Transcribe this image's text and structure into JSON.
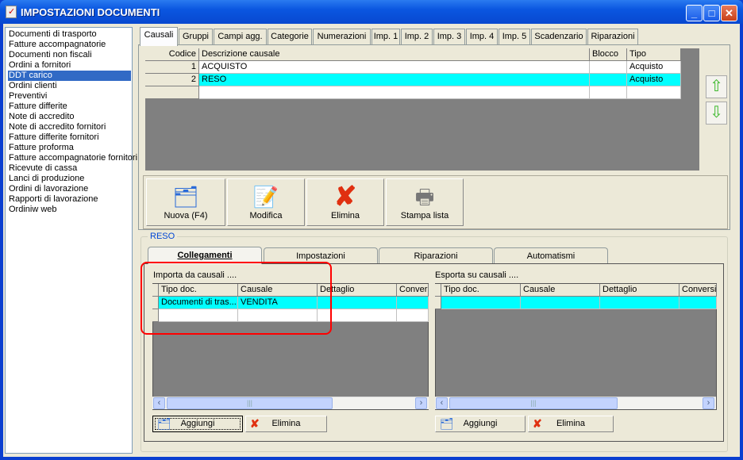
{
  "window": {
    "title": "IMPOSTAZIONI DOCUMENTI",
    "minimize": "_",
    "maximize": "□",
    "close": "✕"
  },
  "sidebar": {
    "items": [
      "Documenti di trasporto",
      "Fatture accompagnatorie",
      "Documenti non fiscali",
      "Ordini a fornitori",
      "DDT carico",
      "Ordini clienti",
      "Preventivi",
      "Fatture differite",
      "Note di accredito",
      "Note di accredito fornitori",
      "Fatture differite fornitori",
      "Fatture proforma",
      "Fatture accompagnatorie fornitori",
      "Ricevute di cassa",
      "Lanci di produzione",
      "Ordini di lavorazione",
      "Rapporti di lavorazione",
      "Ordiniw web"
    ],
    "selected": "DDT carico"
  },
  "tabs": [
    "Causali",
    "Gruppi",
    "Campi agg.",
    "Categorie",
    "Numerazioni",
    "Imp. 1",
    "Imp. 2",
    "Imp. 3",
    "Imp. 4",
    "Imp. 5",
    "Scadenzario",
    "Riparazioni"
  ],
  "causali": {
    "headers": [
      "Codice",
      "Descrizione causale",
      "Blocco",
      "Tipo"
    ],
    "rows": [
      [
        "1",
        "ACQUISTO",
        "",
        "Acquisto"
      ],
      [
        "2",
        "RESO",
        "",
        "Acquisto"
      ]
    ]
  },
  "toolbar": {
    "nuova": "Nuova (F4)",
    "modifica": "Modifica",
    "elimina": "Elimina",
    "stampa": "Stampa lista"
  },
  "group": {
    "label": "RESO",
    "tabs": [
      "Collegamenti",
      "Impostazioni",
      "Riparazioni",
      "Automatismi"
    ]
  },
  "importa": {
    "label": "Importa da causali ....",
    "headers": [
      "Tipo doc.",
      "Causale",
      "Dettaglio",
      "Conver"
    ],
    "rows": [
      [
        "Documenti di tras...",
        "VENDITA",
        "",
        ""
      ]
    ],
    "add": "Aggiungi",
    "delete": "Elimina"
  },
  "esporta": {
    "label": "Esporta su causali ....",
    "headers": [
      "Tipo doc.",
      "Causale",
      "Dettaglio",
      "Conversi"
    ],
    "rows": [
      [
        "",
        "",
        "",
        ""
      ]
    ],
    "add": "Aggiungi",
    "delete": "Elimina"
  },
  "colors": {
    "selection": "#316ac5",
    "highlight_row": "#00ffff",
    "annotation": "#ff0000"
  }
}
